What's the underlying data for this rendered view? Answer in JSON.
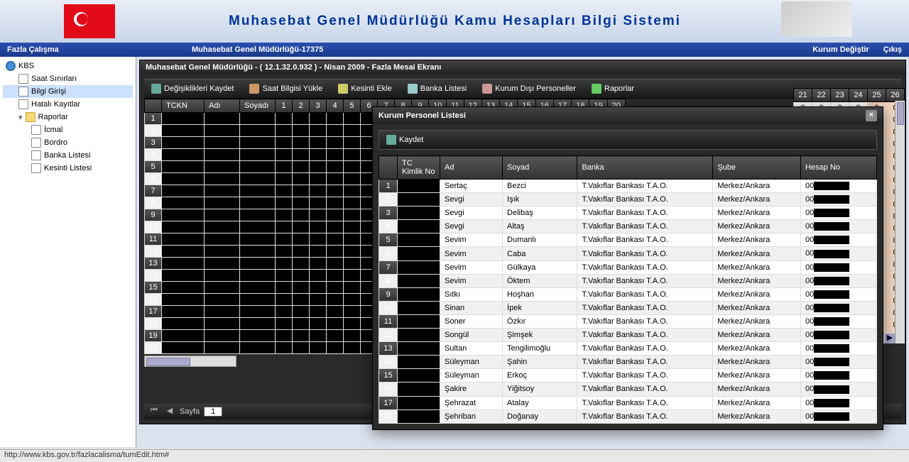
{
  "header": {
    "title": "Muhasebat Genel Müdürlüğü Kamu Hesapları Bilgi Sistemi"
  },
  "topbar": {
    "left": "Fazla Çalışma",
    "center": "Muhasebat Genel Müdürlüğü-17375",
    "change": "Kurum Değiştir",
    "exit": "Çıkış"
  },
  "tree": {
    "root": "KBS",
    "items": [
      "Saat Sınırları",
      "Bilgi Girişi",
      "Hatalı Kayıtlar"
    ],
    "reports": "Raporlar",
    "report_children": [
      "İcmal",
      "Bordro",
      "Banka Listesi",
      "Kesinti Listesi"
    ]
  },
  "panel": {
    "title": "Muhasebat Genel Müdürlüğü - ( 12.1.32.0.932 ) - Nisan 2009 - Fazla Mesai Ekranı"
  },
  "toolbar": {
    "save": "Değişiklikleri Kaydet",
    "load": "Saat Bilgisi Yükle",
    "deduct": "Kesinti Ekle",
    "bank": "Banka Listesi",
    "ext": "Kurum Dışı Personeller",
    "reports": "Raporlar"
  },
  "grid_headers": {
    "tckn": "TCKN",
    "ad": "Adı",
    "soyad": "Soyadı"
  },
  "days_left": [
    "1",
    "2",
    "3",
    "4",
    "5",
    "6",
    "7",
    "8",
    "9",
    "10",
    "11",
    "12",
    "13",
    "14",
    "15",
    "16",
    "17",
    "18",
    "19",
    "20"
  ],
  "days_right": [
    "21",
    "22",
    "23",
    "24",
    "25",
    "26"
  ],
  "row_nums_left": [
    "1",
    "2",
    "3",
    "4",
    "5",
    "6",
    "7",
    "8",
    "9",
    "10",
    "11",
    "12",
    "13",
    "14",
    "15",
    "16",
    "17",
    "18",
    "19",
    "20"
  ],
  "pager": {
    "label": "Sayfa",
    "value": "1"
  },
  "modal": {
    "title": "Kurum Personel Listesi",
    "save": "Kaydet",
    "headers": {
      "tc": "TC Kimlik No",
      "ad": "Ad",
      "soyad": "Soyad",
      "banka": "Banka",
      "sube": "Şube",
      "hesap": "Hesap No"
    },
    "rows": [
      {
        "n": "1",
        "ad": "Sertaç",
        "soyad": "Bezci",
        "banka": "T.Vakıflar Bankası T.A.O.",
        "sube": "Merkez/Ankara",
        "hesap": "00"
      },
      {
        "n": "2",
        "ad": "Sevgi",
        "soyad": "Işık",
        "banka": "T.Vakıflar Bankası T.A.O.",
        "sube": "Merkez/Ankara",
        "hesap": "00"
      },
      {
        "n": "3",
        "ad": "Sevgi",
        "soyad": "Delibaş",
        "banka": "T.Vakıflar Bankası T.A.O.",
        "sube": "Merkez/Ankara",
        "hesap": "00"
      },
      {
        "n": "4",
        "ad": "Sevgi",
        "soyad": "Altaş",
        "banka": "T.Vakıflar Bankası T.A.O.",
        "sube": "Merkez/Ankara",
        "hesap": "00"
      },
      {
        "n": "5",
        "ad": "Sevim",
        "soyad": "Dumanlı",
        "banka": "T.Vakıflar Bankası T.A.O.",
        "sube": "Merkez/Ankara",
        "hesap": "00"
      },
      {
        "n": "6",
        "ad": "Sevim",
        "soyad": "Caba",
        "banka": "T.Vakıflar Bankası T.A.O.",
        "sube": "Merkez/Ankara",
        "hesap": "00"
      },
      {
        "n": "7",
        "ad": "Sevim",
        "soyad": "Gülkaya",
        "banka": "T.Vakıflar Bankası T.A.O.",
        "sube": "Merkez/Ankara",
        "hesap": "00"
      },
      {
        "n": "8",
        "ad": "Sevim",
        "soyad": "Öktem",
        "banka": "T.Vakıflar Bankası T.A.O.",
        "sube": "Merkez/Ankara",
        "hesap": "00"
      },
      {
        "n": "9",
        "ad": "Sıtkı",
        "soyad": "Hoşhan",
        "banka": "T.Vakıflar Bankası T.A.O.",
        "sube": "Merkez/Ankara",
        "hesap": "00"
      },
      {
        "n": "10",
        "ad": "Sinan",
        "soyad": "İpek",
        "banka": "T.Vakıflar Bankası T.A.O.",
        "sube": "Merkez/Ankara",
        "hesap": "00"
      },
      {
        "n": "11",
        "ad": "Soner",
        "soyad": "Özkır",
        "banka": "T.Vakıflar Bankası T.A.O.",
        "sube": "Merkez/Ankara",
        "hesap": "00"
      },
      {
        "n": "12",
        "ad": "Songül",
        "soyad": "Şimşek",
        "banka": "T.Vakıflar Bankası T.A.O.",
        "sube": "Merkez/Ankara",
        "hesap": "00"
      },
      {
        "n": "13",
        "ad": "Sultan",
        "soyad": "Tengilimoğlu",
        "banka": "T.Vakıflar Bankası T.A.O.",
        "sube": "Merkez/Ankara",
        "hesap": "00"
      },
      {
        "n": "14",
        "ad": "Süleyman",
        "soyad": "Şahin",
        "banka": "T.Vakıflar Bankası T.A.O.",
        "sube": "Merkez/Ankara",
        "hesap": "00"
      },
      {
        "n": "15",
        "ad": "Süleyman",
        "soyad": "Erkoç",
        "banka": "T.Vakıflar Bankası T.A.O.",
        "sube": "Merkez/Ankara",
        "hesap": "00"
      },
      {
        "n": "16",
        "ad": "Şakire",
        "soyad": "Yiğitsoy",
        "banka": "T.Vakıflar Bankası T.A.O.",
        "sube": "Merkez/Ankara",
        "hesap": "00"
      },
      {
        "n": "17",
        "ad": "Şehrazat",
        "soyad": "Atalay",
        "banka": "T.Vakıflar Bankası T.A.O.",
        "sube": "Merkez/Ankara",
        "hesap": "00"
      },
      {
        "n": "18",
        "ad": "Şehriban",
        "soyad": "Doğanay",
        "banka": "T.Vakıflar Bankası T.A.O.",
        "sube": "Merkez/Ankara",
        "hesap": "00"
      }
    ]
  },
  "statusbar": "http://www.kbs.gov.tr/fazlacalisma/tumEdit.htm#"
}
